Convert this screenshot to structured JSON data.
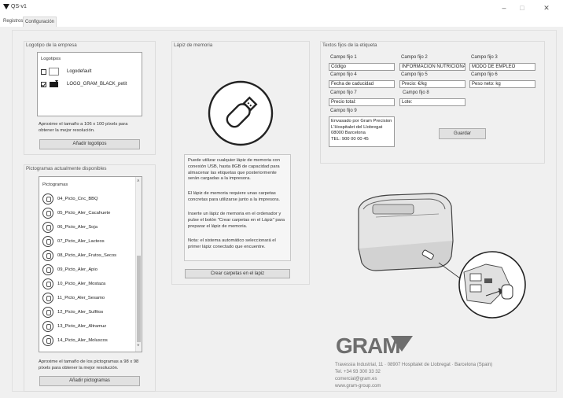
{
  "window": {
    "title": "QS-v1",
    "minimize": "–",
    "maximize": "□",
    "close": "✕"
  },
  "tabs": [
    {
      "label": "Registros"
    },
    {
      "label": "Configuración"
    }
  ],
  "logos": {
    "title": "Logotipo de la empresa",
    "list_title": "Logotipos",
    "items": [
      {
        "name": "Logodefault",
        "checked": false
      },
      {
        "name": "LOGO_GRAM_BLACK_petit",
        "checked": true
      }
    ],
    "hint": "Aproxime el tamaño a 106 x 100 píxels para obtener la mejor resolución.",
    "add_button": "Añadir logotipos"
  },
  "pictos": {
    "title": "Pictogramas actualmente disponibles",
    "list_title": "Pictogramas",
    "items": [
      {
        "name": "04_Picto_Cnc_BBQ"
      },
      {
        "name": "05_Picto_Aler_Cacahuete"
      },
      {
        "name": "06_Picto_Aler_Soja"
      },
      {
        "name": "07_Picto_Aler_Lacteos"
      },
      {
        "name": "08_Picto_Aler_Frutos_Secos"
      },
      {
        "name": "09_Picto_Aler_Apio"
      },
      {
        "name": "10_Picto_Aler_Mostaza"
      },
      {
        "name": "11_Picto_Aler_Sesamo"
      },
      {
        "name": "12_Picto_Aler_Sulfitos"
      },
      {
        "name": "13_Picto_Aler_Altramuz"
      },
      {
        "name": "14_Picto_Aler_Moluscos"
      }
    ],
    "hint": "Aproxime el tamaño de los pictogramas a 98 x 98 píxels para obtener la mejor resolución.",
    "add_button": "Añadir pictogramas"
  },
  "usb": {
    "title": "Lápiz de memoria",
    "info_p1": "Puede utilizar cualquier lápiz de memoria con conexión USB, hasta 8GB de capacidad para almacenar las etiquetas que posteriormente serán cargadas a la impresora.",
    "info_p2": "El lápiz de memoria requiere unas carpetas concretas para utilizarse junto a la impresora.",
    "info_p3": "Inserte un lápiz de memoria en el ordenador y pulse el botón \"Crear carpetas en el Lápiz\" para preparar el lápiz de memoria.",
    "info_p4": "Nota: el sistema automático seleccionará el primer lápiz conectado que encuentre.",
    "create_button": "Crear carpetas en el lapiz"
  },
  "labels": {
    "title": "Textos fijos de la etiqueta",
    "fields": [
      {
        "label": "Campo fijo 1",
        "value": "Código"
      },
      {
        "label": "Campo fijo 2",
        "value": "INFORMACIÓN NUTRICIONAL"
      },
      {
        "label": "Campo fijo 3",
        "value": "MODO DE EMPLEO"
      },
      {
        "label": "Campo fijo 4",
        "value": "Fecha de caducidad"
      },
      {
        "label": "Campo fijo 5",
        "value": "Precio: €/kg"
      },
      {
        "label": "Campo fijo 6",
        "value": "Peso neto: kg"
      },
      {
        "label": "Campo fijo 7",
        "value": "Precio total:"
      },
      {
        "label": "Campo fijo 8",
        "value": "Lote:"
      },
      {
        "label": "Campo fijo 9",
        "value": "Envasado por Gram Precision\nL'Hospitalet del Llobregat\n08000 Barcelona\nTEL: 900 00 00 45"
      }
    ],
    "save_button": "Guardar"
  },
  "gram": {
    "logo_text": "GRAM",
    "address": "Travessia Industrial, 11 · 08907 Hospitalet de Llobregat · Barcelona (Spain)",
    "tel": "Tel. +34 93 300 33 32",
    "email": "comercial@gram.es",
    "web": "www.gram-group.com"
  },
  "colors": {
    "accent": "#1a1a1a",
    "panel_bg": "#f0f0f0",
    "field_bg": "#ffffff",
    "gram_grey": "#6e6e6e"
  }
}
